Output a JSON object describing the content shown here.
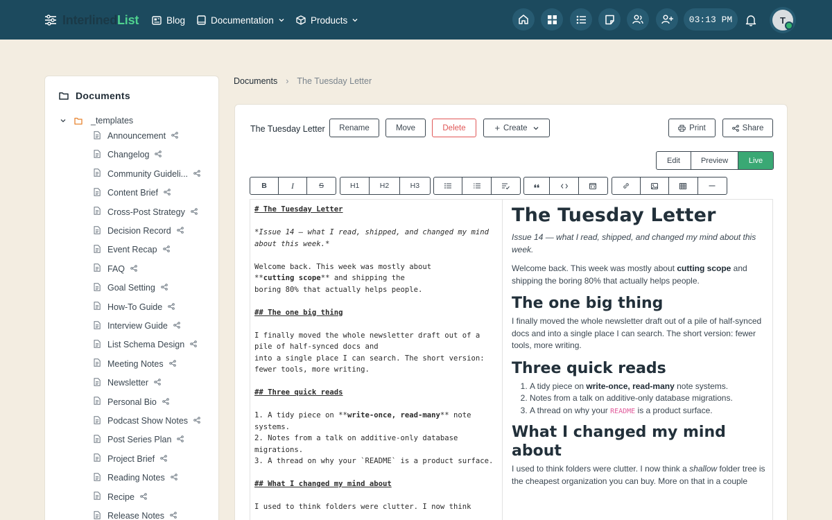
{
  "app": {
    "brand_part1": "Interlined",
    "brand_part2": "List",
    "nav": {
      "blog": "Blog",
      "documentation": "Documentation",
      "products": "Products"
    },
    "time": "03:13 PM",
    "avatar_initial": "T",
    "icons": [
      "home-icon",
      "dashboard-icon",
      "list-icon",
      "note-icon",
      "users-icon",
      "add-user-icon",
      "bell-icon"
    ]
  },
  "sidebar": {
    "title": "Documents",
    "folder": "_templates",
    "items": [
      "Announcement",
      "Changelog",
      "Community Guideli...",
      "Content Brief",
      "Cross-Post Strategy",
      "Decision Record",
      "Event Recap",
      "FAQ",
      "Goal Setting",
      "How-To Guide",
      "Interview Guide",
      "List Schema Design",
      "Meeting Notes",
      "Newsletter",
      "Personal Bio",
      "Podcast Show Notes",
      "Post Series Plan",
      "Project Brief",
      "Reading Notes",
      "Recipe",
      "Release Notes"
    ]
  },
  "breadcrumb": {
    "root": "Documents",
    "sep": "›",
    "current": "The Tuesday Letter"
  },
  "document": {
    "title": "The Tuesday Letter",
    "actions": {
      "rename": "Rename",
      "move": "Move",
      "delete": "Delete",
      "create": "Create",
      "print": "Print",
      "share": "Share"
    },
    "modes": {
      "edit": "Edit",
      "preview": "Preview",
      "live": "Live",
      "active": "Live"
    },
    "toolbar": {
      "bold": "B",
      "italic": "I",
      "strike": "S",
      "h1": "H1",
      "h2": "H2",
      "h3": "H3"
    },
    "source": {
      "l1": "# The Tuesday Letter",
      "l2": "*Issue 14 — what I read, shipped, and changed my mind about this week.*",
      "l3a": "Welcome back. This week was mostly about",
      "l3b1": "**",
      "l3b2": "cutting scope",
      "l3b3": "** and shipping the",
      "l3c": "boring 80% that actually helps people.",
      "l4": "## The one big thing",
      "l5a": "I finally moved the whole newsletter draft out of a pile of half-synced docs and",
      "l5b": "into a single place I can search. The short version: fewer tools, more writing.",
      "l6": "## Three quick reads",
      "l7a1": "1. A tidy piece on **",
      "l7a2": "write-once, read-many",
      "l7a3": "** note systems.",
      "l7b": "2. Notes from a talk on additive-only database migrations.",
      "l7c": "3. A thread on why your `README` is a product surface.",
      "l8": "## What I changed my mind about",
      "l9": "I used to think folders were clutter. I now think"
    },
    "preview": {
      "h1": "The Tuesday Letter",
      "sub": "Issue 14 — what I read, shipped, and changed my mind about this week.",
      "p1a": "Welcome back. This week was mostly about ",
      "p1b": "cutting scope",
      "p1c": " and shipping the boring 80% that actually helps people.",
      "h2a": "The one big thing",
      "p2": "I finally moved the whole newsletter draft out of a pile of half-synced docs and into a single place I can search. The short version: fewer tools, more writing.",
      "h2b": "Three quick reads",
      "li1a": "A tidy piece on ",
      "li1b": "write-once, read-many",
      "li1c": " note systems.",
      "li2": "Notes from a talk on additive-only database migrations.",
      "li3a": "A thread on why your ",
      "li3b": "README",
      "li3c": " is a product surface.",
      "h2c": "What I changed my mind about",
      "p3a": "I used to think folders were clutter. I now think a ",
      "p3b": "shallow",
      "p3c": " folder tree is the cheapest organization you can buy. More on that in a couple"
    }
  }
}
